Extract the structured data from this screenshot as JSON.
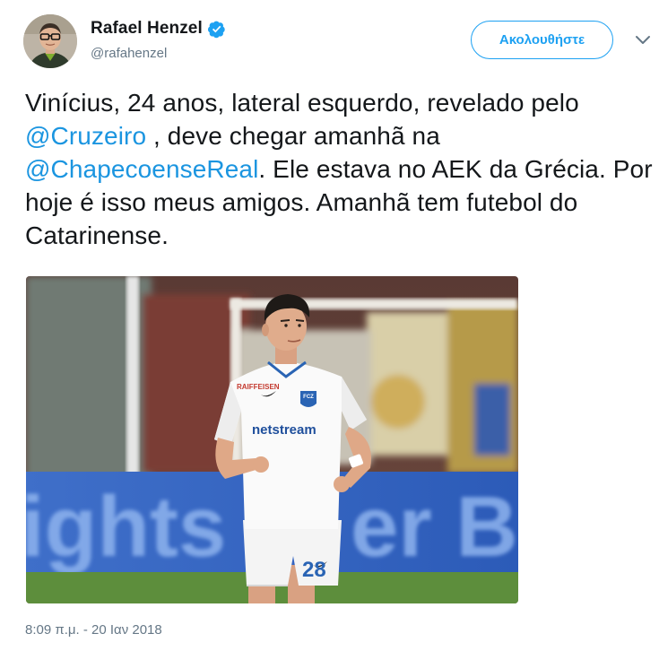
{
  "author": {
    "display_name": "Rafael Henzel",
    "handle": "@rafahenzel",
    "verified": true
  },
  "follow_button": {
    "label": "Ακολουθήστε"
  },
  "tweet": {
    "segments": [
      {
        "type": "text",
        "value": "Vinícius, 24 anos, lateral esquerdo, revelado pelo "
      },
      {
        "type": "mention",
        "value": "@Cruzeiro"
      },
      {
        "type": "text",
        "value": " , deve chegar amanhã na "
      },
      {
        "type": "mention",
        "value": "@ChapecoenseReal"
      },
      {
        "type": "text",
        "value": ". Ele estava no AEK da Grécia. Por hoje é isso meus amigos. Amanhã tem futebol do Catarinense."
      }
    ]
  },
  "media": {
    "jersey_sponsor": "RAIFFEISEN",
    "jersey_brand": "netstream",
    "jersey_club": "FCZ",
    "shorts_number": "28",
    "background_text": "ights in er Bl"
  },
  "timestamp": "8:09 π.μ. - 20 Ιαν 2018",
  "colors": {
    "link": "#1b95e0",
    "follow": "#1da1f2",
    "secondary": "#657786"
  },
  "icons": {
    "verified": "verified-badge-icon",
    "caret": "chevron-down-icon"
  }
}
